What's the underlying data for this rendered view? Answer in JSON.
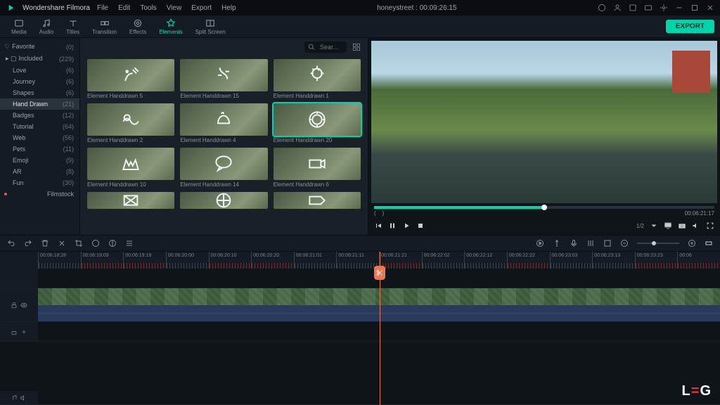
{
  "app": {
    "name": "Wondershare Filmora",
    "title": "honeystreet : 00:09:26:15"
  },
  "menu": [
    "File",
    "Edit",
    "Tools",
    "View",
    "Export",
    "Help"
  ],
  "tabs": [
    {
      "label": "Media"
    },
    {
      "label": "Audio"
    },
    {
      "label": "Titles"
    },
    {
      "label": "Transition"
    },
    {
      "label": "Effects"
    },
    {
      "label": "Elements"
    },
    {
      "label": "Split Screen"
    }
  ],
  "export_label": "EXPORT",
  "search": {
    "placeholder": "Sear..."
  },
  "sidebar": {
    "favorite": {
      "label": "Favorite",
      "count": "(0)"
    },
    "included": {
      "label": "Included",
      "count": "(229)"
    },
    "items": [
      {
        "label": "Love",
        "count": "(6)"
      },
      {
        "label": "Journey",
        "count": "(6)"
      },
      {
        "label": "Shapes",
        "count": "(6)"
      },
      {
        "label": "Hand Drawn",
        "count": "(21)"
      },
      {
        "label": "Badges",
        "count": "(12)"
      },
      {
        "label": "Tutorial",
        "count": "(64)"
      },
      {
        "label": "Web",
        "count": "(56)"
      },
      {
        "label": "Pets",
        "count": "(11)"
      },
      {
        "label": "Emoji",
        "count": "(9)"
      },
      {
        "label": "AR",
        "count": "(8)"
      },
      {
        "label": "Fun",
        "count": "(30)"
      }
    ],
    "filmstock": {
      "label": "Filmstock"
    }
  },
  "assets": [
    "Element Handdrawn 5",
    "Element Handdrawn 15",
    "Element Handdrawn 1",
    "Element Handdrawn 2",
    "Element Handdrawn 4",
    "Element Handdrawn 20",
    "Element Handdrawn 10",
    "Element Handdrawn 14",
    "Element Handdrawn 6"
  ],
  "preview": {
    "timecode": "00:06:21:17",
    "ratio": "1/2"
  },
  "timeline": {
    "ticks": [
      "00:06:18:28",
      "00:06:19:09",
      "00:06:19:19",
      "00:06:20:00",
      "00:06:20:10",
      "00:06:20:20",
      "00:06:21:01",
      "00:06:21:11",
      "00:06:21:21",
      "00:06:22:02",
      "00:06:22:12",
      "00:06:22:22",
      "00:06:23:03",
      "00:06:23:13",
      "00:06:23:23",
      "00:06"
    ]
  },
  "watermark": {
    "l": "L",
    "mid": "=",
    "g": "G"
  }
}
